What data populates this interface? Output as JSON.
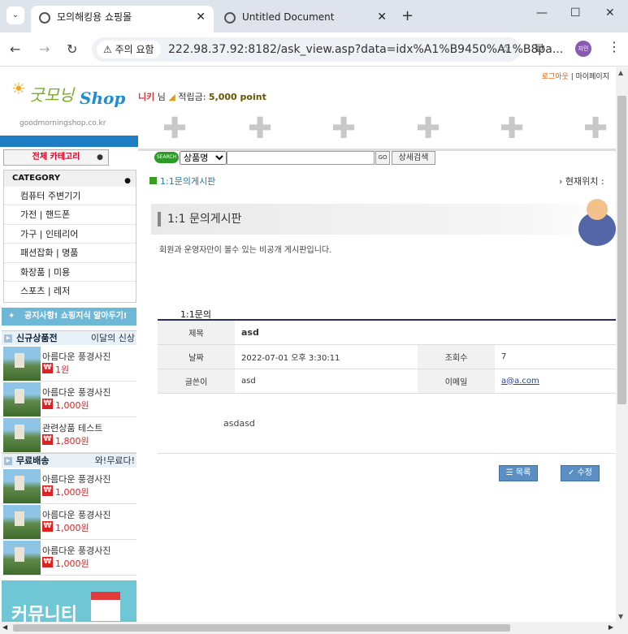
{
  "browser": {
    "tabs": [
      {
        "title": "모의해킹용 쇼핑몰",
        "close": "✕"
      },
      {
        "title": "Untitled Document",
        "close": "✕"
      }
    ],
    "new_tab": "+",
    "security_chip": "주의 요함",
    "url": "222.98.37.92:8182/ask_view.asp?data=idx%A1%B9450%A1%B8pa...",
    "profile_label": "지민"
  },
  "site": {
    "logo_text": "굿모닝",
    "logo_shop": "Shop",
    "logo_domain": "goodmorningshop.co.kr",
    "logout": "로그아웃",
    "mypage": "마이페이지",
    "user_name": "니키",
    "user_suffix": "님",
    "points_label": "적립금:",
    "points_value": "5,000 point",
    "all_categories": "전체 카테고리",
    "search": {
      "badge": "SEARCH",
      "field_option": "상품명",
      "go": "GO",
      "advanced": "상세검색"
    },
    "category_header": "CATEGORY",
    "categories": [
      "컴퓨터 주변기기",
      "가전 | 핸드폰",
      "가구 | 인테리어",
      "패션잡화 | 명품",
      "화장품 | 미용",
      "스포츠 | 레저"
    ],
    "notice_banner": "공지사항! 쇼핑지식 알아두기!",
    "new_section": {
      "title": "신규상품전",
      "right": "이달의 신상"
    },
    "new_products": [
      {
        "name": "아름다운 풍경사진",
        "price": "1원"
      },
      {
        "name": "아름다운 풍경사진",
        "price": "1,000원"
      },
      {
        "name": "관련상품 테스트",
        "price": "1,800원"
      }
    ],
    "free_section": {
      "title": "무료배송",
      "right": "와!무료다!"
    },
    "free_products": [
      {
        "name": "아름다운 풍경사진",
        "price": "1,000원"
      },
      {
        "name": "아름다운 풍경사진",
        "price": "1,000원"
      },
      {
        "name": "아름다운 풍경사진",
        "price": "1,000원"
      }
    ],
    "won_symbol": "₩",
    "community": "커뮤니티"
  },
  "content": {
    "breadcrumb": "1:1문의게시판",
    "location": "› 현재위치 :",
    "page_title": "1:1 문의게시판",
    "description": "회원과 운영자만이 볼수 있는 비공개 게시판입니다.",
    "table_caption": "1:1문의",
    "fields": {
      "subject_label": "제목",
      "subject": "asd",
      "date_label": "날짜",
      "date": "2022-07-01 오후 3:30:11",
      "views_label": "조회수",
      "views": "7",
      "author_label": "글쓴이",
      "author": "asd",
      "email_label": "이메일",
      "email": "a@a.com"
    },
    "body": "asdasd",
    "list_button": "목록",
    "edit_button": "수정"
  }
}
